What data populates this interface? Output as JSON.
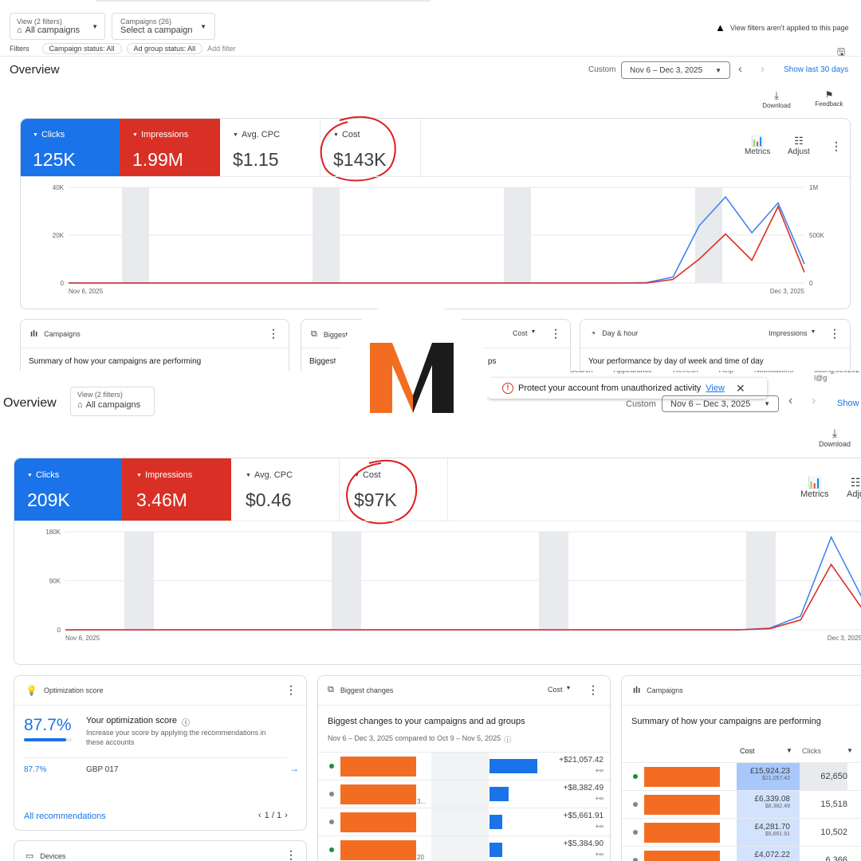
{
  "top": {
    "view_filters": "View (2 filters)",
    "all_campaigns": "All campaigns",
    "campaigns_count": "Campaigns (26)",
    "select_campaign": "Select a campaign",
    "filters_warning": "View filters aren't applied to this page",
    "filters_label": "Filters",
    "chip_campaign_status": "Campaign status: All",
    "chip_ad_group_status": "Ad group status: All",
    "add_filter": "Add filter",
    "overview": "Overview",
    "custom": "Custom",
    "date_range": "Nov 6 – Dec 3, 2025",
    "show_last_30": "Show last 30 days",
    "download": "Download",
    "feedback": "Feedback",
    "metrics": [
      {
        "label": "Clicks",
        "value": "125K"
      },
      {
        "label": "Impressions",
        "value": "1.99M"
      },
      {
        "label": "Avg. CPC",
        "value": "$1.15"
      },
      {
        "label": "Cost",
        "value": "$143K"
      }
    ],
    "metrics_btn": "Metrics",
    "adjust_btn": "Adjust",
    "y_left": [
      "40K",
      "20K",
      "0"
    ],
    "y_right": [
      "1M",
      "500K",
      "0"
    ],
    "x_start": "Nov 6, 2025",
    "x_end": "Dec 3, 2025",
    "card_campaigns_title": "Campaigns",
    "card_campaigns_text": "Summary of how your campaigns are performing",
    "card_biggest_title": "Biggest",
    "card_biggest_text": "Biggest",
    "card_biggest_tail": "ps",
    "card_biggest_sort": "Cost",
    "card_day_title": "Day & hour",
    "card_day_sort": "Impressions",
    "card_day_text": "Your performance by day of week and time of day"
  },
  "logo": {
    "letter": "M",
    "colors": {
      "orange": "#f26d21",
      "black": "#1b1b1b"
    }
  },
  "bottom": {
    "header_fragments": [
      "Search",
      "Appearance",
      "Refresh",
      "Help",
      "Notifications",
      "duong.ce0202 l@g"
    ],
    "protect_text": "Protect your account from unauthorized activity",
    "protect_link": "View",
    "overview": "Overview",
    "view_filters": "View (2 filters)",
    "all_campaigns": "All campaigns",
    "custom": "Custom",
    "date_range": "Nov 6 – Dec 3, 2025",
    "show": "Show",
    "download": "Download",
    "metrics": [
      {
        "label": "Clicks",
        "value": "209K"
      },
      {
        "label": "Impressions",
        "value": "3.46M"
      },
      {
        "label": "Avg. CPC",
        "value": "$0.46"
      },
      {
        "label": "Cost",
        "value": "$97K"
      }
    ],
    "metrics_btn": "Metrics",
    "adjust_btn": "Adju",
    "y_left": [
      "180K",
      "90K",
      "0"
    ],
    "x_start": "Nov 6, 2025",
    "x_end": "Dec 3, 2025",
    "opt": {
      "title": "Optimization score",
      "score": "87.7%",
      "heading": "Your optimization score",
      "desc": "Increase your score by applying the recommendations in these accounts",
      "row_score": "87.7%",
      "row_account": "GBP 017",
      "all_recs": "All recommendations",
      "pager": "1 / 1",
      "progress": 0.877
    },
    "biggest": {
      "title": "Biggest changes",
      "sort": "Cost",
      "heading": "Biggest changes to your campaigns and ad groups",
      "compare": "Nov 6 – Dec 3, 2025 compared to Oct 9 – Nov 5, 2025",
      "rows": [
        {
          "value": "+$21,057.42",
          "sub": "+∞",
          "share": 1.0,
          "dot": "green",
          "note": ""
        },
        {
          "value": "+$8,382.49",
          "sub": "+∞",
          "share": 0.4,
          "dot": "grey",
          "note": "3..."
        },
        {
          "value": "+$5,661.91",
          "sub": "+∞",
          "share": 0.27,
          "dot": "grey",
          "note": ""
        },
        {
          "value": "+$5,384.90",
          "sub": "+∞",
          "share": 0.26,
          "dot": "green",
          "note": "20"
        }
      ]
    },
    "campaigns": {
      "title": "Campaigns",
      "heading": "Summary of how your campaigns are performing",
      "col_cost": "Cost",
      "col_clicks": "Clicks",
      "rows": [
        {
          "cost": "£15,924.23",
          "cost_sub": "$21,057.42",
          "clicks": "62,650",
          "dot": "green"
        },
        {
          "cost": "£6,339.08",
          "cost_sub": "$8,382.49",
          "clicks": "15,518",
          "dot": "grey"
        },
        {
          "cost": "£4,281.70",
          "cost_sub": "$5,661.91",
          "clicks": "10,502",
          "dot": "grey"
        },
        {
          "cost": "£4,072.22",
          "cost_sub": "",
          "clicks": "6,366",
          "dot": "grey"
        }
      ]
    },
    "devices": {
      "title": "Devices"
    }
  },
  "chart_data": [
    {
      "type": "line",
      "title": "",
      "x": [
        "Nov 6, 2025",
        "Dec 3, 2025"
      ],
      "series": [
        {
          "name": "Clicks",
          "color": "#4285f4",
          "values": [
            0,
            0,
            0,
            0,
            0,
            0,
            0,
            0,
            0,
            0,
            0,
            0,
            0,
            0,
            0,
            0,
            0,
            0,
            0,
            0,
            0,
            0,
            200,
            2500,
            24000,
            36000,
            21000,
            33500,
            8000
          ]
        },
        {
          "name": "Impressions",
          "color": "#d93025",
          "values": [
            0,
            0,
            0,
            0,
            0,
            0,
            0,
            0,
            0,
            0,
            0,
            0,
            0,
            0,
            0,
            0,
            0,
            0,
            0,
            0,
            0,
            0,
            0,
            1500,
            10000,
            20500,
            9500,
            32000,
            4500
          ]
        }
      ],
      "ylim": [
        0,
        40000
      ]
    },
    {
      "type": "line",
      "title": "",
      "x": [
        "Nov 6, 2025",
        "Dec 3, 2025"
      ],
      "series": [
        {
          "name": "Clicks",
          "color": "#4285f4",
          "values": [
            0,
            0,
            0,
            0,
            0,
            0,
            0,
            0,
            0,
            0,
            0,
            0,
            0,
            0,
            0,
            0,
            0,
            0,
            0,
            0,
            0,
            0,
            0,
            3000,
            25000,
            170000,
            60000
          ]
        },
        {
          "name": "Impressions",
          "color": "#d93025",
          "values": [
            0,
            0,
            0,
            0,
            0,
            0,
            0,
            0,
            0,
            0,
            0,
            0,
            0,
            0,
            0,
            0,
            0,
            0,
            0,
            0,
            0,
            0,
            0,
            2000,
            18000,
            120000,
            40000
          ]
        }
      ],
      "ylim": [
        0,
        180000
      ]
    }
  ]
}
